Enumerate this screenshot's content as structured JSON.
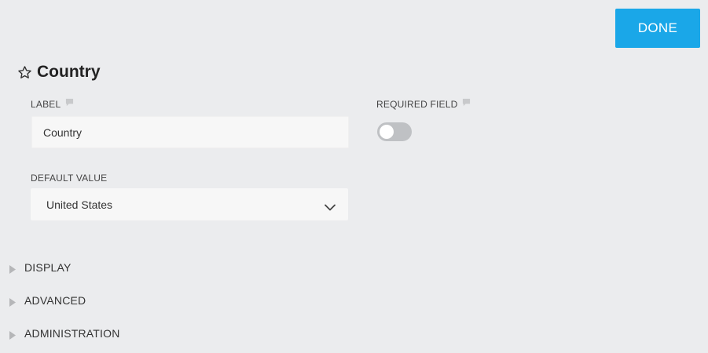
{
  "toolbar": {
    "done_label": "DONE"
  },
  "field": {
    "title": "Country",
    "label_caption": "LABEL",
    "label_value": "Country",
    "required_caption": "REQUIRED FIELD",
    "required_on": false,
    "default_caption": "DEFAULT VALUE",
    "default_value": "United States"
  },
  "sections": [
    {
      "label": "DISPLAY"
    },
    {
      "label": "ADVANCED"
    },
    {
      "label": "ADMINISTRATION"
    }
  ],
  "colors": {
    "accent": "#1aa7e8",
    "background": "#ebecee",
    "input_bg": "#f7f7f7",
    "toggle_off": "#bfc1c4"
  },
  "icons": {
    "favorite": "star-icon",
    "comment": "comment-icon",
    "dropdown": "chevron-down-icon",
    "expand": "caret-right-icon"
  }
}
